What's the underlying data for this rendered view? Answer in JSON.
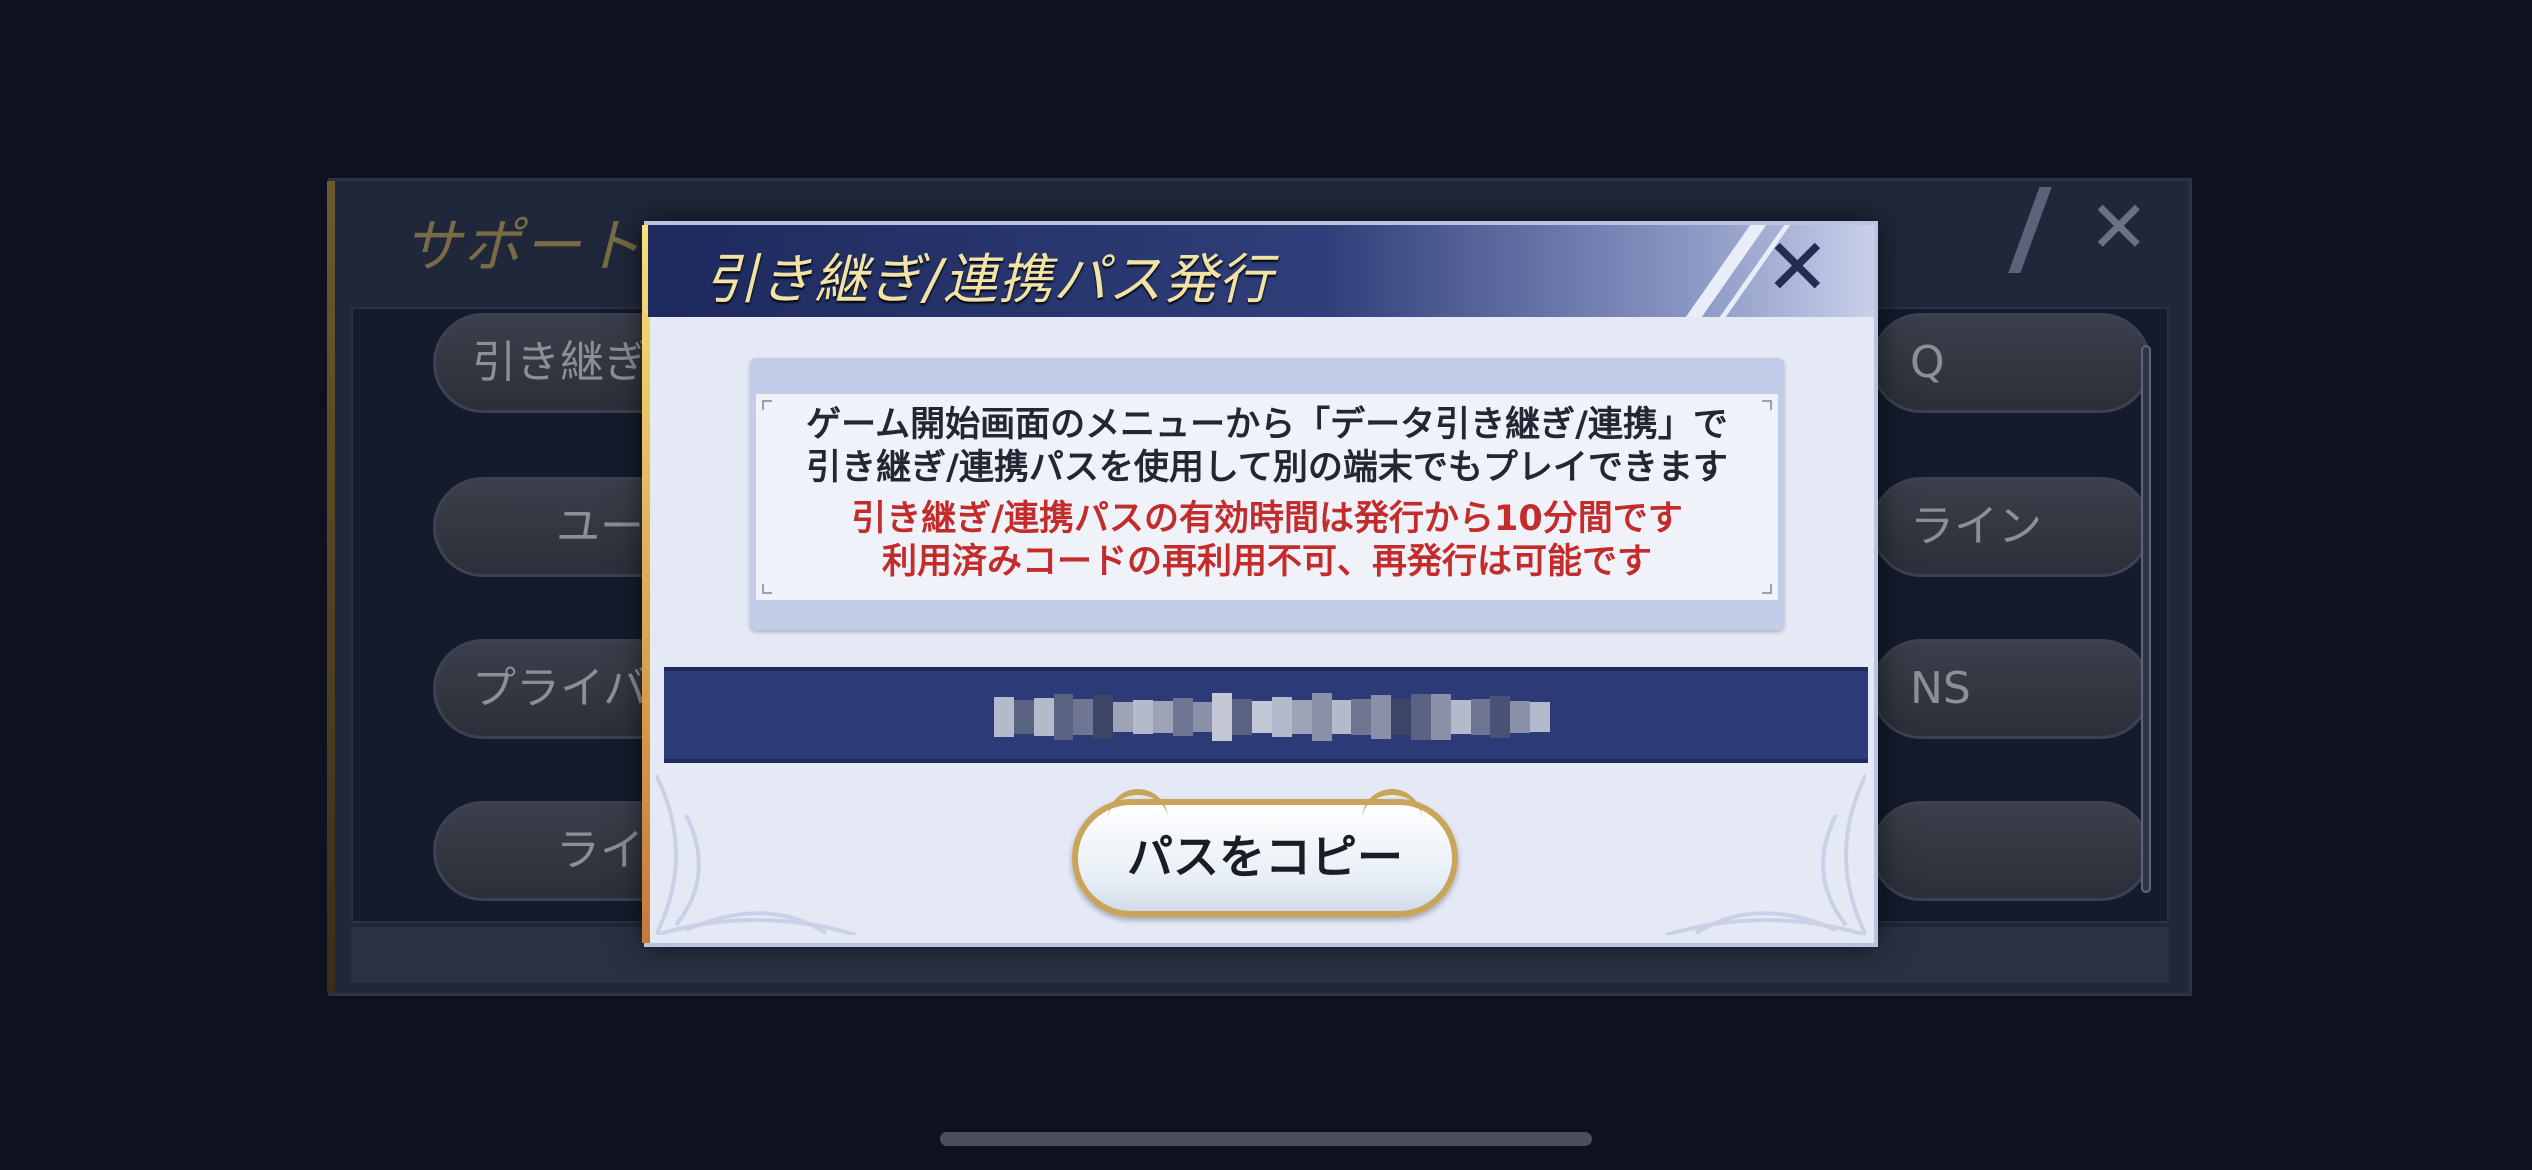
{
  "support": {
    "title": "サポート",
    "buttons_left": [
      "引き継ぎ/",
      "ユー",
      "プライバ",
      "ライ"
    ],
    "buttons_right": [
      "Q",
      "ライン",
      "NS",
      ""
    ]
  },
  "dialog": {
    "title": "引き継ぎ/連携パス発行",
    "info_lines": [
      "ゲーム開始画面のメニューから「データ引き継ぎ/連携」で",
      "引き継ぎ/連携パスを使用して別の端末でもプレイできます"
    ],
    "warning_lines": [
      "引き継ぎ/連携パスの有効時間は発行から10分間です",
      "利用済みコードの再利用不可、再発行は可能です"
    ],
    "copy_label": "パスをコピー",
    "code_redacted": true
  },
  "colors": {
    "background": "#0d1120",
    "dialog_header": "#2f3e7a",
    "code_bar": "#2c3b77",
    "warning_text": "#c42c2c",
    "title_text": "#f1e3a6",
    "gold_accent": "#c9a55a"
  },
  "icons": [
    "close-icon",
    "ornament-corner-icon"
  ]
}
